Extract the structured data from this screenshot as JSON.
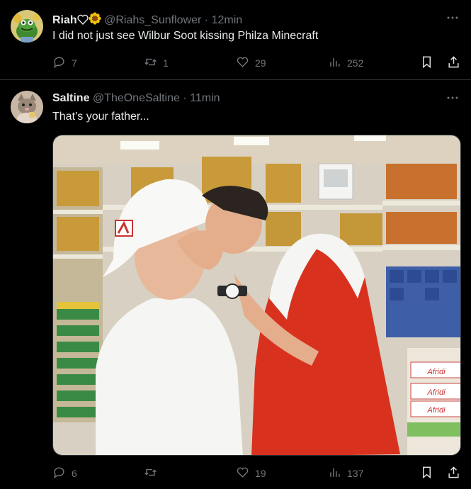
{
  "tweets": [
    {
      "name": "Riah",
      "handle": "@Riahs_Sunflower",
      "separator": "·",
      "time": "12min",
      "text": "I did not just see Wilbur Soot kissing Philza Minecraft",
      "replies": "7",
      "retweets": "1",
      "likes": "29",
      "views": "252"
    },
    {
      "name": "Saltine",
      "handle": "@TheOneSaltine",
      "separator": "·",
      "time": "11min",
      "text": "That’s your father...",
      "replies": "6",
      "retweets": "",
      "likes": "19",
      "views": "137",
      "media_labels": [
        "Afridi",
        "Afridi",
        "Afridi"
      ]
    }
  ],
  "colors": {
    "background": "#000000",
    "text": "#e7e9ea",
    "muted": "#71767b",
    "divider": "#2f3336"
  },
  "icons": [
    "more-icon",
    "reply-icon",
    "retweet-icon",
    "like-icon",
    "views-icon",
    "bookmark-icon",
    "share-icon",
    "heart-outline-icon",
    "sunflower-icon"
  ]
}
